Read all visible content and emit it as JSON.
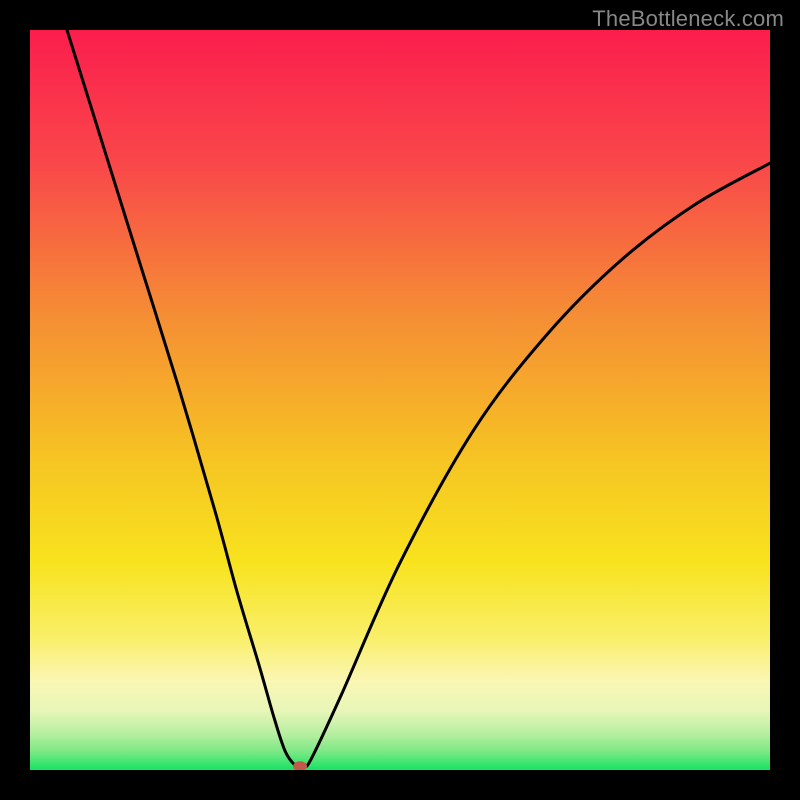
{
  "watermark": "TheBottleneck.com",
  "colors": {
    "frame": "#000000",
    "gradient_top": "#fb1e4d",
    "gradient_mid_upper": "#f58c35",
    "gradient_mid": "#f8e31e",
    "gradient_mid_lower": "#f8f38d",
    "gradient_lower": "#d9f49a",
    "gradient_bottom": "#17e364",
    "curve": "#000000",
    "marker": "#c25a4a",
    "watermark": "#888888"
  },
  "chart_data": {
    "type": "line",
    "title": "",
    "xlabel": "",
    "ylabel": "",
    "xlim": [
      0,
      100
    ],
    "ylim": [
      0,
      100
    ],
    "grid": false,
    "legend": false,
    "series": [
      {
        "name": "bottleneck-curve",
        "x": [
          5,
          10,
          15,
          20,
          25,
          28,
          31,
          33,
          34.5,
          36,
          37,
          38,
          42,
          50,
          60,
          70,
          80,
          90,
          100
        ],
        "y": [
          100,
          84,
          68,
          52,
          35,
          24,
          14,
          7,
          2.5,
          0.5,
          0.5,
          1.5,
          10,
          28,
          46,
          59,
          69,
          76.5,
          82
        ]
      }
    ],
    "annotations": [
      {
        "name": "optimal-point-marker",
        "x": 36.5,
        "y": 0.5
      }
    ]
  }
}
